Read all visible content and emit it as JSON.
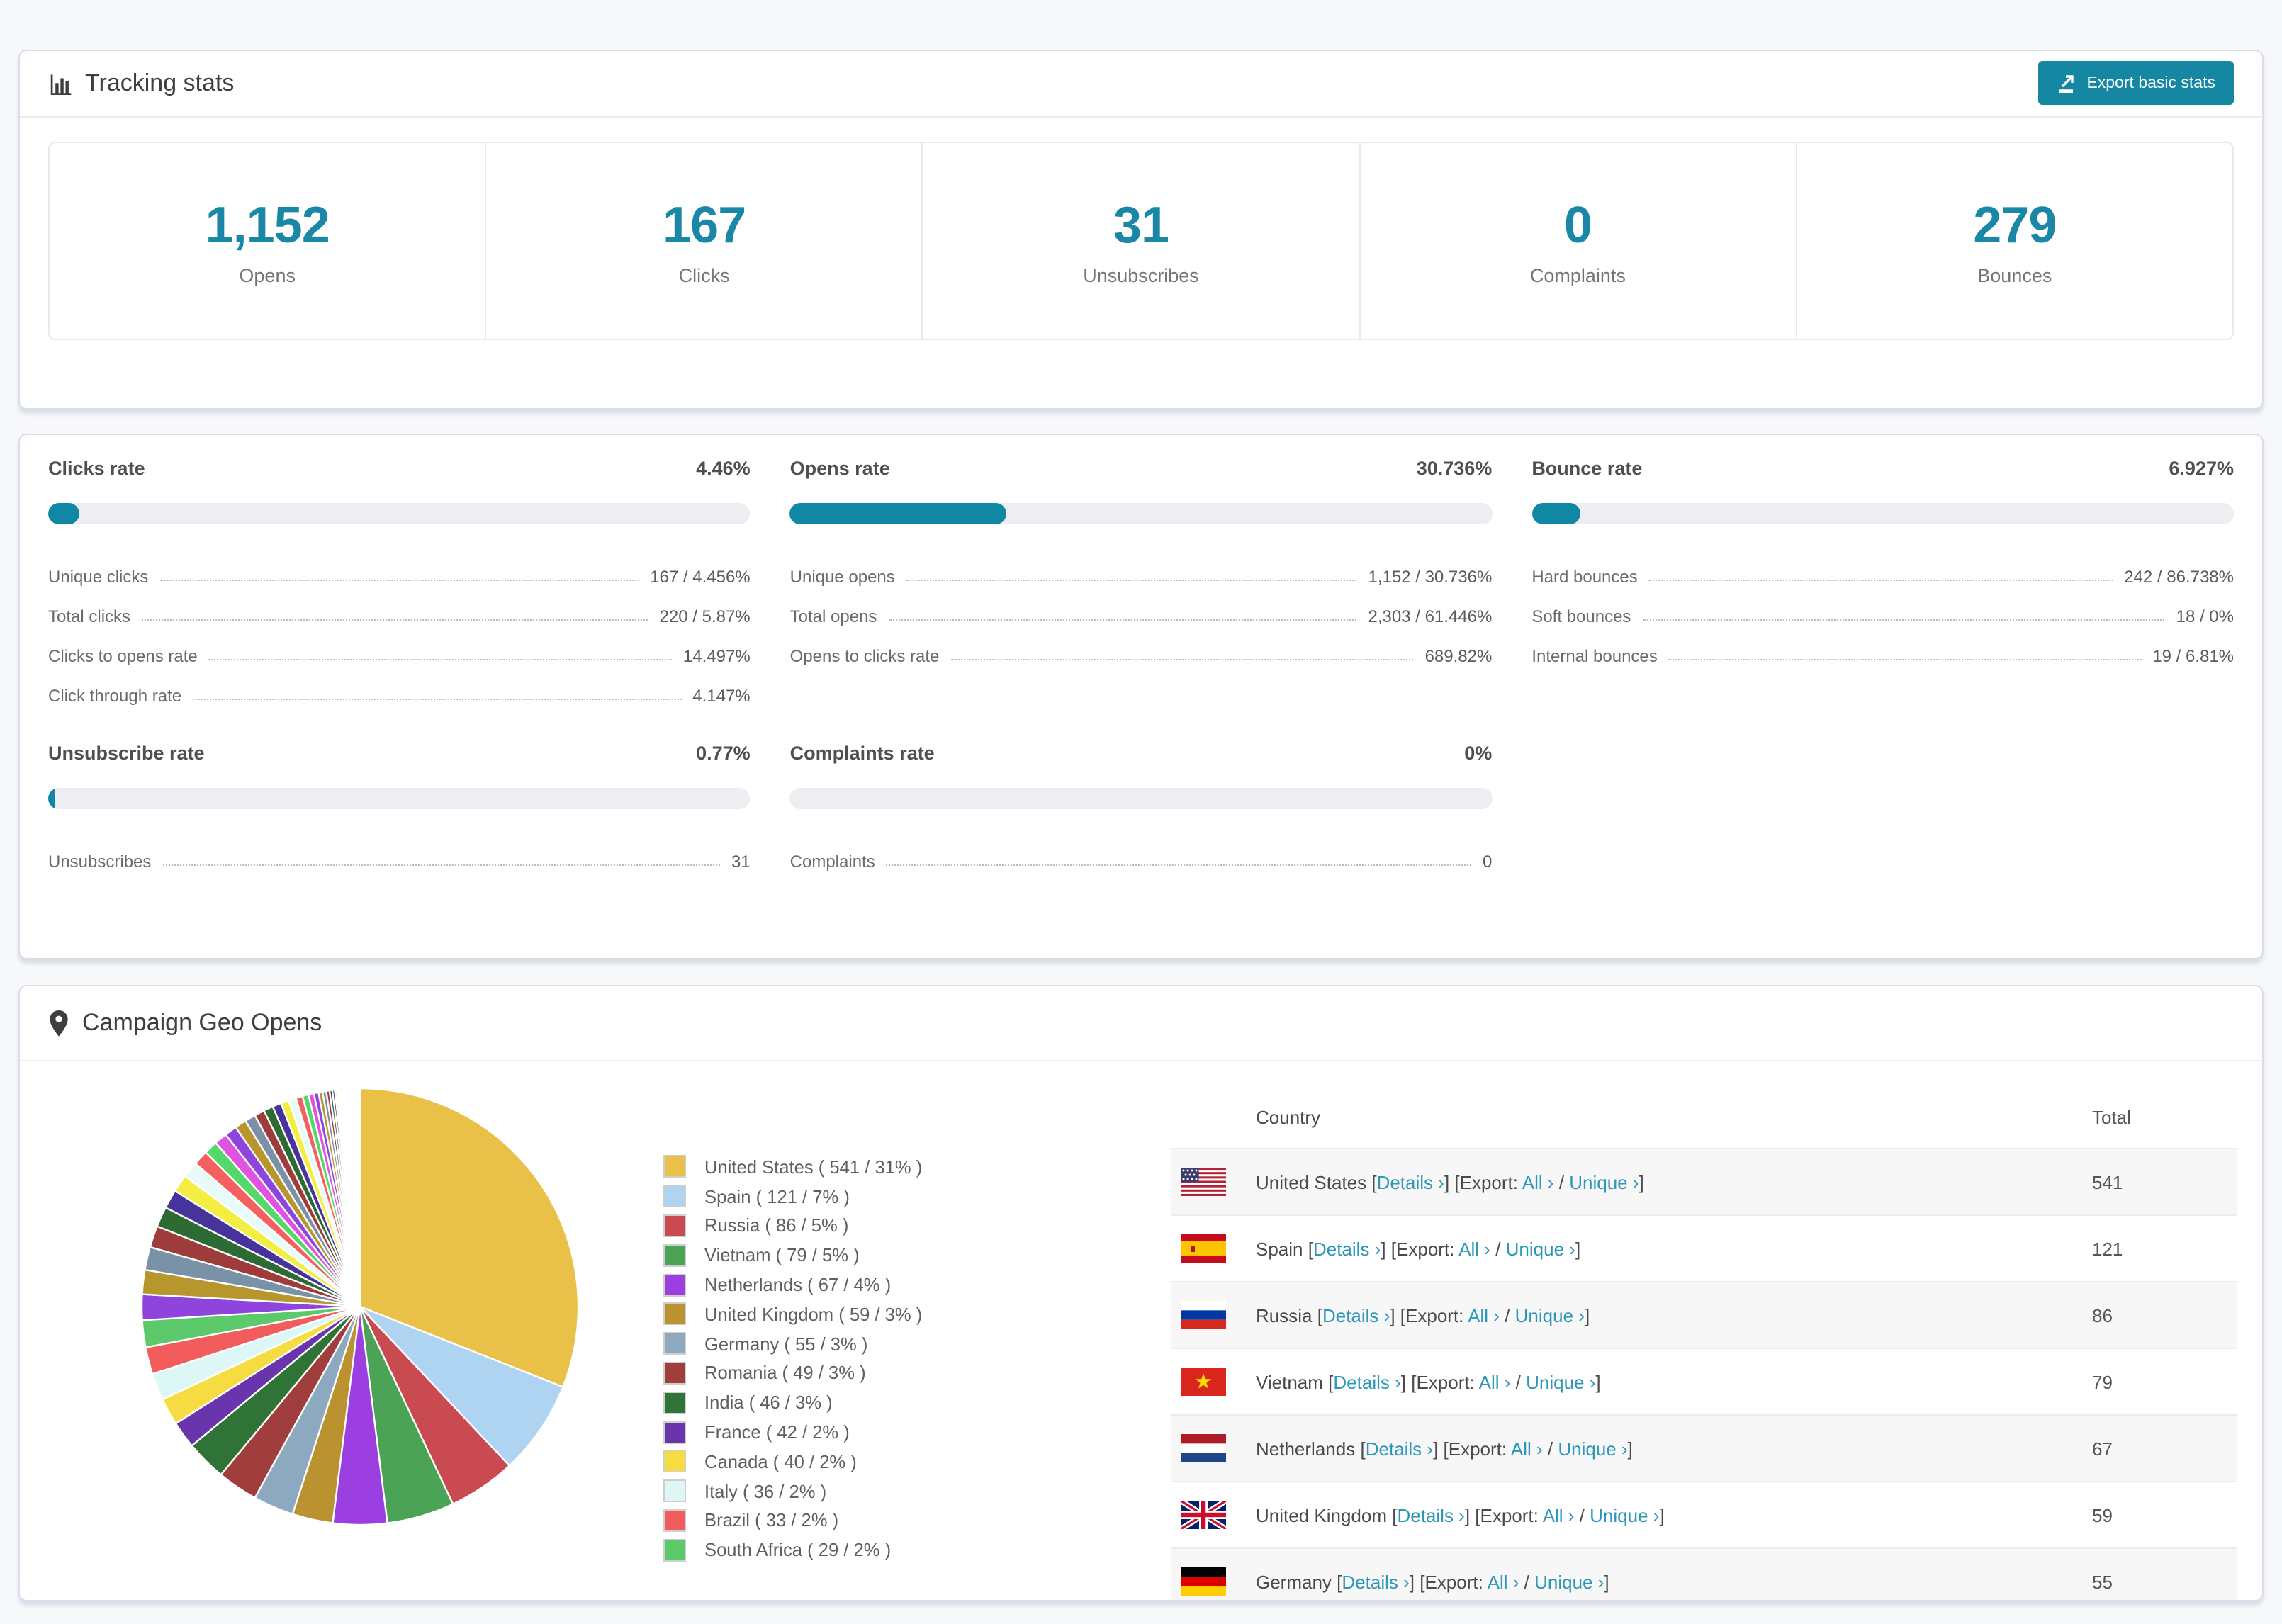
{
  "tracking": {
    "title": "Tracking stats",
    "export_button": "Export basic stats",
    "stats": [
      {
        "value": "1,152",
        "label": "Opens"
      },
      {
        "value": "167",
        "label": "Clicks"
      },
      {
        "value": "31",
        "label": "Unsubscribes"
      },
      {
        "value": "0",
        "label": "Complaints"
      },
      {
        "value": "279",
        "label": "Bounces"
      }
    ]
  },
  "rates": {
    "blocks": [
      {
        "title": "Clicks rate",
        "rate": "4.46%",
        "progress_pct": 4.46,
        "items": [
          {
            "label": "Unique clicks",
            "value": "167 / 4.456%"
          },
          {
            "label": "Total clicks",
            "value": "220 / 5.87%"
          },
          {
            "label": "Clicks to opens rate",
            "value": "14.497%"
          },
          {
            "label": "Click through rate",
            "value": "4.147%"
          }
        ]
      },
      {
        "title": "Opens rate",
        "rate": "30.736%",
        "progress_pct": 30.736,
        "items": [
          {
            "label": "Unique opens",
            "value": "1,152 / 30.736%"
          },
          {
            "label": "Total opens",
            "value": "2,303 / 61.446%"
          },
          {
            "label": "Opens to clicks rate",
            "value": "689.82%"
          }
        ]
      },
      {
        "title": "Bounce rate",
        "rate": "6.927%",
        "progress_pct": 6.927,
        "items": [
          {
            "label": "Hard bounces",
            "value": "242 / 86.738%"
          },
          {
            "label": "Soft bounces",
            "value": "18 / 0%"
          },
          {
            "label": "Internal bounces",
            "value": "19 / 6.81%"
          }
        ]
      },
      {
        "title": "Unsubscribe rate",
        "rate": "0.77%",
        "progress_pct": 0.77,
        "items": [
          {
            "label": "Unsubscribes",
            "value": "31"
          }
        ]
      },
      {
        "title": "Complaints rate",
        "rate": "0%",
        "progress_pct": 0,
        "items": [
          {
            "label": "Complaints",
            "value": "0"
          }
        ]
      }
    ]
  },
  "geo": {
    "title": "Campaign Geo Opens",
    "columns": {
      "country": "Country",
      "total": "Total"
    },
    "row_labels": {
      "details": "Details ›",
      "export": "Export:",
      "all": "All ›",
      "unique": "Unique ›"
    },
    "rows": [
      {
        "flag": "us",
        "country": "United States",
        "total": "541"
      },
      {
        "flag": "es",
        "country": "Spain",
        "total": "121"
      },
      {
        "flag": "ru",
        "country": "Russia",
        "total": "86"
      },
      {
        "flag": "vn",
        "country": "Vietnam",
        "total": "79"
      },
      {
        "flag": "nl",
        "country": "Netherlands",
        "total": "67"
      },
      {
        "flag": "gb",
        "country": "United Kingdom",
        "total": "59"
      },
      {
        "flag": "de",
        "country": "Germany",
        "total": "55"
      }
    ]
  },
  "chart_data": {
    "type": "pie",
    "title": "Campaign Geo Opens",
    "legend_position": "right",
    "start_angle_deg": -90,
    "direction": "clockwise",
    "slices": [
      {
        "label": "United States",
        "count": 541,
        "pct": 31,
        "color": "#e9c148"
      },
      {
        "label": "Spain",
        "count": 121,
        "pct": 7,
        "color": "#aed4f2"
      },
      {
        "label": "Russia",
        "count": 86,
        "pct": 5,
        "color": "#c94a51"
      },
      {
        "label": "Vietnam",
        "count": 79,
        "pct": 5,
        "color": "#4ba455"
      },
      {
        "label": "Netherlands",
        "count": 67,
        "pct": 4,
        "color": "#9b3fe0"
      },
      {
        "label": "United Kingdom",
        "count": 59,
        "pct": 3,
        "color": "#bb9230"
      },
      {
        "label": "Germany",
        "count": 55,
        "pct": 3,
        "color": "#8ca9c0"
      },
      {
        "label": "Romania",
        "count": 49,
        "pct": 3,
        "color": "#a03d3d"
      },
      {
        "label": "India",
        "count": 46,
        "pct": 3,
        "color": "#2f7436"
      },
      {
        "label": "France",
        "count": 42,
        "pct": 2,
        "color": "#6a34ad"
      },
      {
        "label": "Canada",
        "count": 40,
        "pct": 2,
        "color": "#f6dc40"
      },
      {
        "label": "Italy",
        "count": 36,
        "pct": 2,
        "color": "#dcf7f5"
      },
      {
        "label": "Brazil",
        "count": 33,
        "pct": 2,
        "color": "#f25c5c"
      },
      {
        "label": "South Africa",
        "count": 29,
        "pct": 2,
        "color": "#5cc96a"
      }
    ],
    "other_slices_pct": [
      1.9,
      1.8,
      1.7,
      1.6,
      1.5,
      1.4,
      1.3,
      1.2,
      1.1,
      1.0,
      0.95,
      0.9,
      0.85,
      0.8,
      0.75,
      0.7,
      0.65,
      0.6,
      0.55,
      0.5,
      0.45,
      0.4,
      0.35,
      0.3,
      0.27,
      0.24,
      0.21,
      0.18,
      0.15,
      0.13,
      0.11,
      0.09,
      0.08,
      0.07,
      0.06,
      0.05,
      0.04,
      0.03
    ],
    "other_slice_palette": [
      "#8e44dd",
      "#b8962e",
      "#7a92a8",
      "#9e3c3c",
      "#2e6b34",
      "#46339b",
      "#f4ee42",
      "#e8fbf9",
      "#f3605f",
      "#55d86a",
      "#e052e0"
    ]
  },
  "colors": {
    "accent_teal": "#0f87a5",
    "link_teal": "#2d97b8",
    "stat_number": "#1b87a6"
  }
}
